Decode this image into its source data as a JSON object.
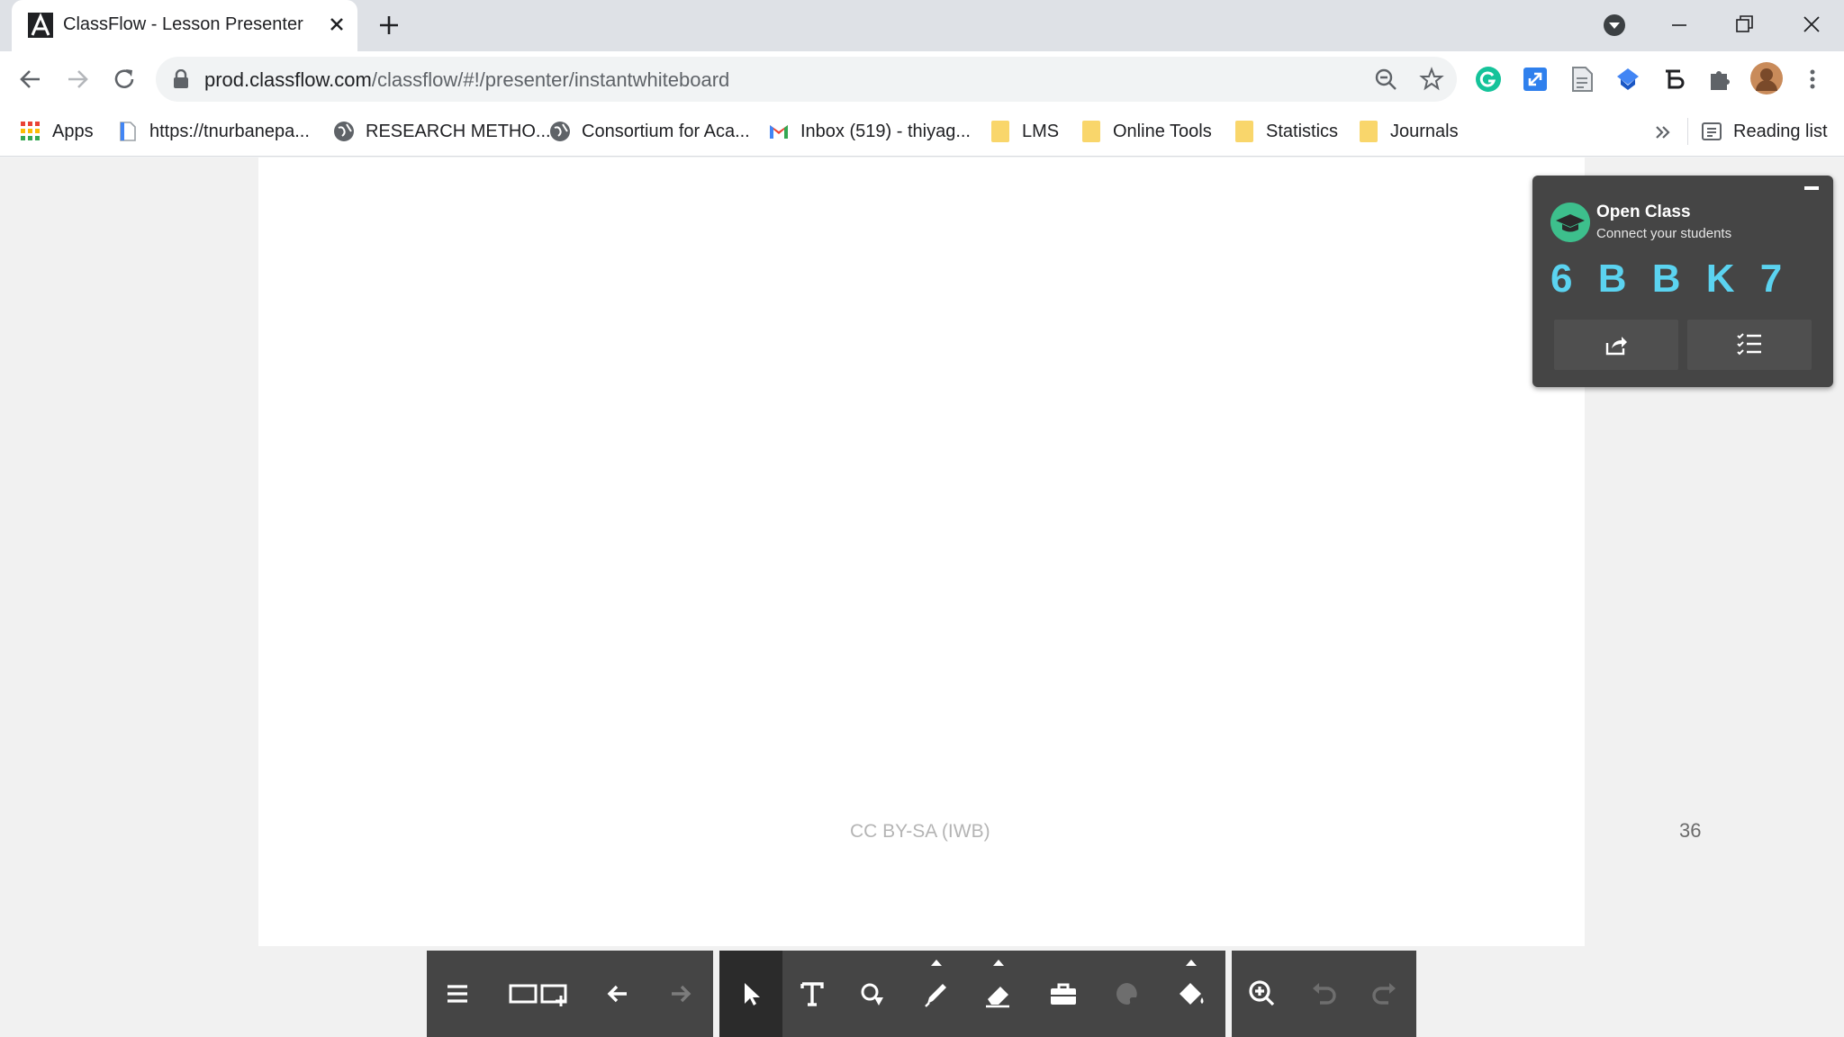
{
  "browser": {
    "tab_title": "ClassFlow - Lesson Presenter",
    "url_host": "prod.classflow.com",
    "url_path": "/classflow/#!/presenter/instantwhiteboard"
  },
  "bookmarks": [
    {
      "label": "Apps",
      "icon": "apps-grid-icon"
    },
    {
      "label": "https://tnurbanepa...",
      "icon": "page-icon"
    },
    {
      "label": "RESEARCH METHO...",
      "icon": "globe-icon"
    },
    {
      "label": "Consortium for Aca...",
      "icon": "globe-icon"
    },
    {
      "label": "Inbox (519) - thiyag...",
      "icon": "gmail-icon"
    },
    {
      "label": "LMS",
      "icon": "folder-icon"
    },
    {
      "label": "Online Tools",
      "icon": "folder-icon"
    },
    {
      "label": "Statistics",
      "icon": "folder-icon"
    },
    {
      "label": "Journals",
      "icon": "folder-icon"
    }
  ],
  "reading_list": "Reading list",
  "open_class": {
    "title": "Open Class",
    "subtitle": "Connect your students",
    "code": "6 B B K 7"
  },
  "watermark": "CC BY-SA (IWB)",
  "page_number": "36",
  "colors": {
    "accent": "#5bd3f0",
    "panel": "#454545",
    "avatar": "#3dbf8c"
  }
}
